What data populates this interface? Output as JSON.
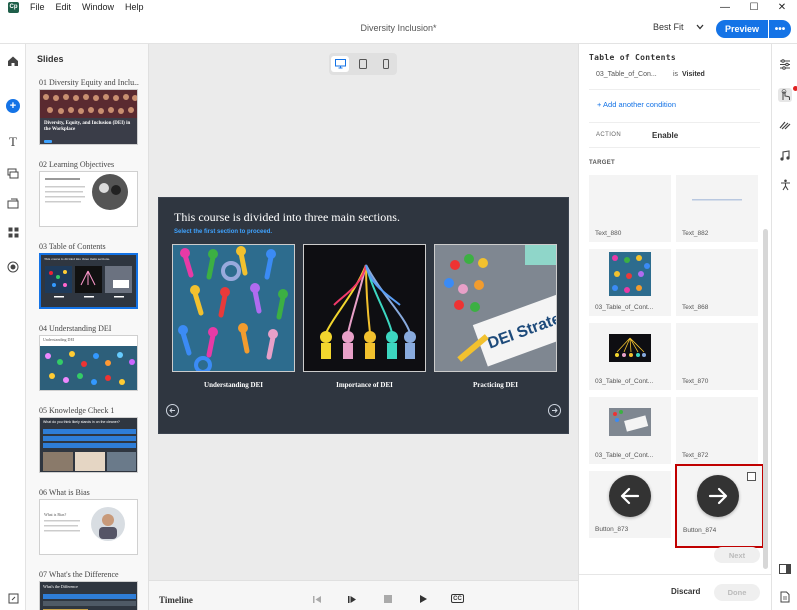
{
  "menu": [
    "File",
    "Edit",
    "Window",
    "Help"
  ],
  "app_logo": "Cp",
  "window_controls": [
    "—",
    "☐",
    "✕"
  ],
  "doc_title": "Diversity Inclusion*",
  "fit_select": "Best Fit",
  "preview_label": "Preview",
  "more_label": "•••",
  "slides_panel": {
    "title": "Slides",
    "items": [
      {
        "label": "01  Diversity Equity and Inclu..."
      },
      {
        "label": "02  Learning Objectives"
      },
      {
        "label": "03  Table of Contents"
      },
      {
        "label": "04  Understanding DEI"
      },
      {
        "label": "05  Knowledge Check 1"
      },
      {
        "label": "06  What is Bias"
      },
      {
        "label": "07  What's the Difference"
      }
    ],
    "thumb_texts": {
      "s1_title": "Diversity, Equity, and Inclusion (DEI) in the Workplace",
      "s3_title": "This course is divided into three main sections.",
      "s4_title": "Understanding DEI",
      "s5_title": "What do you think likely stands in on the cleaner?",
      "s6_title": "What is Bias?",
      "s7_title": "What's the Difference"
    }
  },
  "stage": {
    "heading": "This course is divided into three main sections.",
    "subheading": "Select the first section to proceed.",
    "cards": [
      {
        "label": "Understanding DEI"
      },
      {
        "label": "Importance of DEI"
      },
      {
        "label": "Practicing DEI"
      }
    ],
    "dei_sign_text": "DEI Strate"
  },
  "timeline": {
    "label": "Timeline",
    "controls": [
      "step-back",
      "step-forward",
      "stop",
      "play",
      "CC"
    ]
  },
  "right_panel": {
    "title": "Table of Contents",
    "condition": {
      "name": "03_Table_of_Con...",
      "operator": "is",
      "value": "Visited"
    },
    "add_condition": "+ Add another condition",
    "action_key": "ACTION",
    "action_value": "Enable",
    "target_label": "TARGET",
    "targets": [
      {
        "name": "Text_880"
      },
      {
        "name": "Text_882"
      },
      {
        "name": "03_Table_of_Cont..."
      },
      {
        "name": "Text_868"
      },
      {
        "name": "03_Table_of_Cont..."
      },
      {
        "name": "Text_870"
      },
      {
        "name": "03_Table_of_Cont..."
      },
      {
        "name": "Text_872"
      },
      {
        "name": "Button_873"
      },
      {
        "name": "Button_874"
      }
    ],
    "next_label": "Next",
    "discard_label": "Discard",
    "done_label": "Done"
  },
  "colors": {
    "accent": "#1473e6",
    "highlight": "#c00000",
    "slide_bg": "#2f3640"
  },
  "icons": {
    "left_rail": [
      "home-icon",
      "add-icon",
      "text-icon",
      "media-icon",
      "interactions-icon",
      "assets-icon",
      "record-icon",
      "export-icon"
    ],
    "right_rail": [
      "properties-icon",
      "interaction-icon",
      "animation-icon",
      "audio-icon",
      "accessibility-icon",
      "panel-icon",
      "notes-icon"
    ]
  }
}
